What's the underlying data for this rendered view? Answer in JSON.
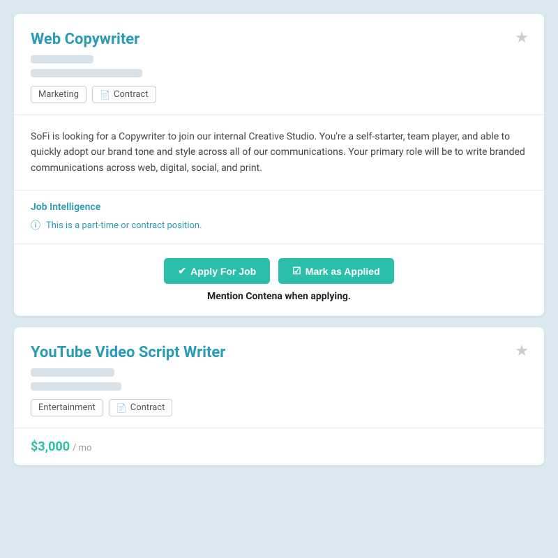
{
  "card1": {
    "title": "Web Copywriter",
    "tags": [
      {
        "label": "Marketing",
        "icon": ""
      },
      {
        "label": "Contract",
        "icon": "📄"
      }
    ],
    "description": "SoFi is looking for a Copywriter to join our internal Creative Studio. You're a self-starter, team player, and able to quickly adopt our brand tone and style across all of our communications. Your primary role will be to write branded communications across web, digital, social, and print.",
    "job_intelligence_title": "Job Intelligence",
    "job_intelligence_item": "This is a part-time or contract position.",
    "apply_label": "Apply For Job",
    "mark_label": "Mark as Applied",
    "mention_text": "Mention Contena when applying.",
    "star_label": "★"
  },
  "card2": {
    "title": "YouTube Video Script Writer",
    "tags": [
      {
        "label": "Entertainment",
        "icon": ""
      },
      {
        "label": "Contract",
        "icon": "📄"
      }
    ],
    "salary": "$3,000",
    "salary_period": "/ mo",
    "star_label": "★"
  }
}
